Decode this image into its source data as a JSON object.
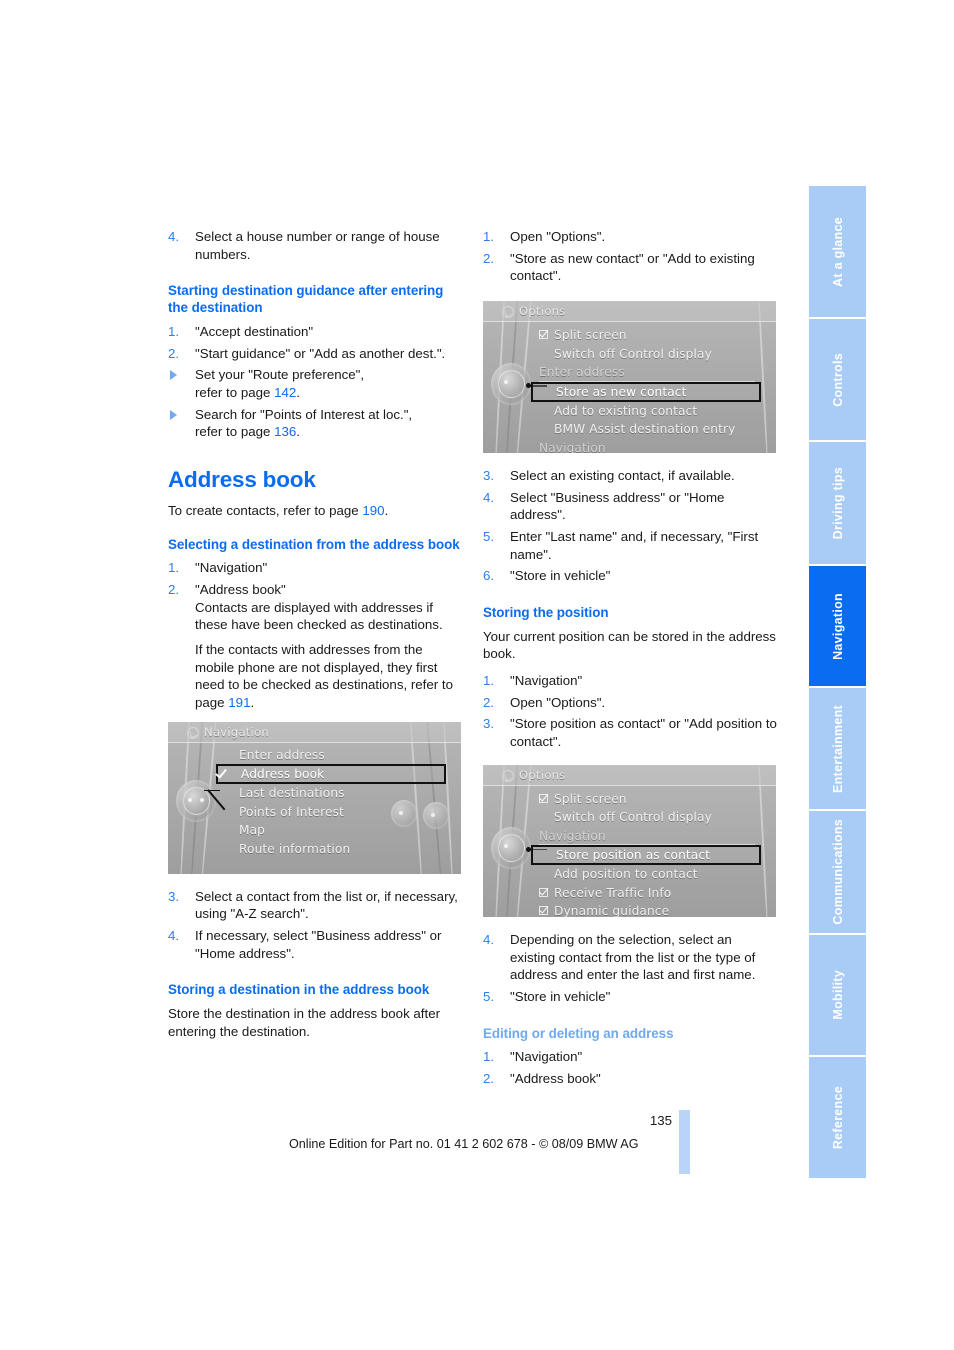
{
  "page": {
    "number": "135",
    "footer_text": "Online Edition for Part no. 01 41 2 602 678 - © 08/09 BMW AG"
  },
  "tab_rail": {
    "tabs": [
      {
        "label": "At a glance",
        "active": false
      },
      {
        "label": "Controls",
        "active": false
      },
      {
        "label": "Driving tips",
        "active": false
      },
      {
        "label": "Navigation",
        "active": true
      },
      {
        "label": "Entertainment",
        "active": false
      },
      {
        "label": "Communications",
        "active": false
      },
      {
        "label": "Mobility",
        "active": false
      },
      {
        "label": "Reference",
        "active": false
      }
    ]
  },
  "colors": {
    "accent_blue": "#0a6cf0",
    "light_blue": "#6fa9ee",
    "tab_inactive": "#a8ccf5",
    "text": "#1a1a1a"
  },
  "left_column": {
    "step_house_number": {
      "num": "4.",
      "text": "Select a house number or range of house numbers."
    },
    "heading_starting_guidance": "Starting destination guidance after entering the destination",
    "starting_guidance_steps": [
      {
        "marker": "1.",
        "type": "number",
        "text": "\"Accept destination\""
      },
      {
        "marker": "2.",
        "type": "number",
        "text": "\"Start guidance\" or \"Add as another dest.\"."
      },
      {
        "marker": "▷",
        "type": "triangle",
        "text": "Set your \"Route preference\",",
        "line2_prefix": "refer to page ",
        "line2_ref": "142",
        "line2_suffix": "."
      },
      {
        "marker": "▷",
        "type": "triangle",
        "text": "Search for \"Points of Interest at loc.\",",
        "line2_prefix": "refer to page ",
        "line2_ref": "136",
        "line2_suffix": "."
      }
    ],
    "heading_address_book": "Address book",
    "address_book_intro_prefix": "To create contacts, refer to page ",
    "address_book_intro_ref": "190",
    "address_book_intro_suffix": ".",
    "heading_selecting_destination": "Selecting a destination from the address book",
    "selecting_steps": [
      {
        "marker": "1.",
        "text": "\"Navigation\""
      },
      {
        "marker": "2.",
        "text": "\"Address book\""
      }
    ],
    "selecting_sub_1": "Contacts are displayed with addresses if these have been checked as destinations.",
    "selecting_sub_2_prefix": "If the contacts with addresses from the mobile phone are not displayed, they first need to be checked as destinations, refer to page ",
    "selecting_sub_2_ref": "191",
    "selecting_sub_2_suffix": ".",
    "navigation_screenshot": {
      "title": "Navigation",
      "title_icon": "back-arrow-icon",
      "items": [
        {
          "label": "Enter address",
          "state": "normal"
        },
        {
          "label": "Address book",
          "state": "selected",
          "checked": true
        },
        {
          "label": "Last destinations",
          "state": "normal"
        },
        {
          "label": "Points of Interest",
          "state": "normal"
        },
        {
          "label": "Map",
          "state": "normal"
        },
        {
          "label": "Route information",
          "state": "normal"
        }
      ]
    },
    "selecting_steps_after": [
      {
        "marker": "3.",
        "text": "Select a contact from the list or, if necessary, using \"A-Z search\"."
      },
      {
        "marker": "4.",
        "text": "If necessary, select \"Business address\" or \"Home address\"."
      }
    ],
    "heading_storing_destination": "Storing a destination in the address book",
    "storing_destination_intro": "Store the destination in the address book after entering the destination."
  },
  "right_column": {
    "storing_steps_top": [
      {
        "marker": "1.",
        "text": "Open \"Options\"."
      },
      {
        "marker": "2.",
        "text": "\"Store as new contact\" or \"Add to existing contact\"."
      }
    ],
    "options_screenshot_1": {
      "title": "Options",
      "title_icon": "options-icon",
      "items": [
        {
          "label": "Split screen",
          "state": "normal",
          "checkbox": true
        },
        {
          "label": "Switch off Control display",
          "state": "normal"
        },
        {
          "label": "Enter address",
          "state": "dim"
        },
        {
          "label": "Store as new contact",
          "state": "selected"
        },
        {
          "label": "Add to existing contact",
          "state": "normal"
        },
        {
          "label": "BMW Assist destination entry",
          "state": "normal"
        },
        {
          "label": "Navigation",
          "state": "dim"
        }
      ]
    },
    "storing_steps_after": [
      {
        "marker": "3.",
        "text": "Select an existing contact, if available."
      },
      {
        "marker": "4.",
        "text": "Select \"Business address\" or \"Home address\"."
      },
      {
        "marker": "5.",
        "text": "Enter \"Last name\" and, if necessary, \"First name\"."
      },
      {
        "marker": "6.",
        "text": "\"Store in vehicle\""
      }
    ],
    "heading_storing_position": "Storing the position",
    "storing_position_intro": "Your current position can be stored in the address book.",
    "storing_position_steps": [
      {
        "marker": "1.",
        "text": "\"Navigation\""
      },
      {
        "marker": "2.",
        "text": "Open \"Options\"."
      },
      {
        "marker": "3.",
        "text": "\"Store position as contact\" or \"Add position to contact\"."
      }
    ],
    "options_screenshot_2": {
      "title": "Options",
      "title_icon": "options-icon",
      "items": [
        {
          "label": "Split screen",
          "state": "normal",
          "checkbox": true
        },
        {
          "label": "Switch off Control display",
          "state": "normal"
        },
        {
          "label": "Navigation",
          "state": "dim"
        },
        {
          "label": "Store position as contact",
          "state": "selected"
        },
        {
          "label": "Add position to contact",
          "state": "normal"
        },
        {
          "label": "Receive Traffic Info",
          "state": "normal",
          "checkbox": true
        },
        {
          "label": "Dynamic guidance",
          "state": "normal",
          "checkbox": true
        }
      ]
    },
    "storing_position_steps_after": [
      {
        "marker": "4.",
        "text": "Depending on the selection, select an existing contact from the list or the type of address and enter the last and first name."
      },
      {
        "marker": "5.",
        "text": "\"Store in vehicle\""
      }
    ],
    "heading_editing_deleting": "Editing or deleting an address",
    "editing_steps": [
      {
        "marker": "1.",
        "text": "\"Navigation\""
      },
      {
        "marker": "2.",
        "text": "\"Address book\""
      }
    ]
  }
}
